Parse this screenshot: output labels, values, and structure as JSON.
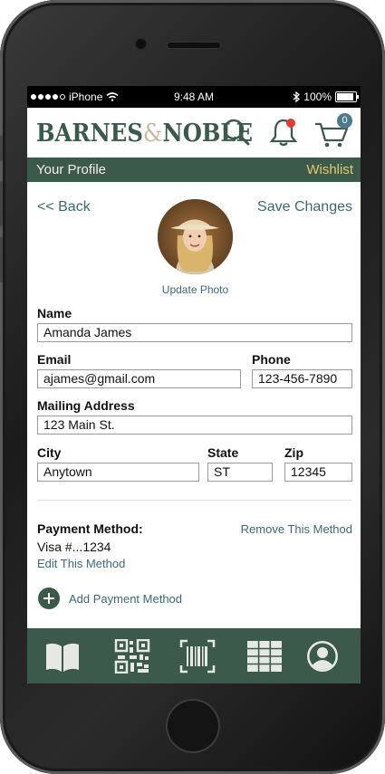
{
  "status_bar": {
    "carrier": "iPhone",
    "time": "9:48 AM",
    "battery": "100%",
    "battery_level": 1.0
  },
  "header": {
    "logo_left": "BARNES",
    "logo_amp": "&",
    "logo_right": "NOBLE",
    "cart_count": "0"
  },
  "nav": {
    "title": "Your Profile",
    "wishlist": "Wishlist"
  },
  "actions": {
    "back": "<< Back",
    "save": "Save Changes",
    "update_photo": "Update Photo"
  },
  "form": {
    "name": {
      "label": "Name",
      "value": "Amanda James"
    },
    "email": {
      "label": "Email",
      "value": "ajames@gmail.com"
    },
    "phone": {
      "label": "Phone",
      "value": "123-456-7890"
    },
    "address": {
      "label": "Mailing Address",
      "value": "123 Main St."
    },
    "city": {
      "label": "City",
      "value": "Anytown"
    },
    "state": {
      "label": "State",
      "value": "ST"
    },
    "zip": {
      "label": "Zip",
      "value": "12345"
    }
  },
  "payment": {
    "label": "Payment Method:",
    "value": "Visa #...1234",
    "edit": "Edit This Method",
    "remove": "Remove This Method",
    "add": "Add Payment Method"
  },
  "bottom_nav": [
    "book-icon",
    "qr-code-icon",
    "barcode-scan-icon",
    "grid-icon",
    "profile-icon"
  ],
  "colors": {
    "brand_green": "#3c5a4b",
    "wishlist_gold": "#e3c96b",
    "link": "#3c6a72",
    "notification_red": "#e53935"
  }
}
